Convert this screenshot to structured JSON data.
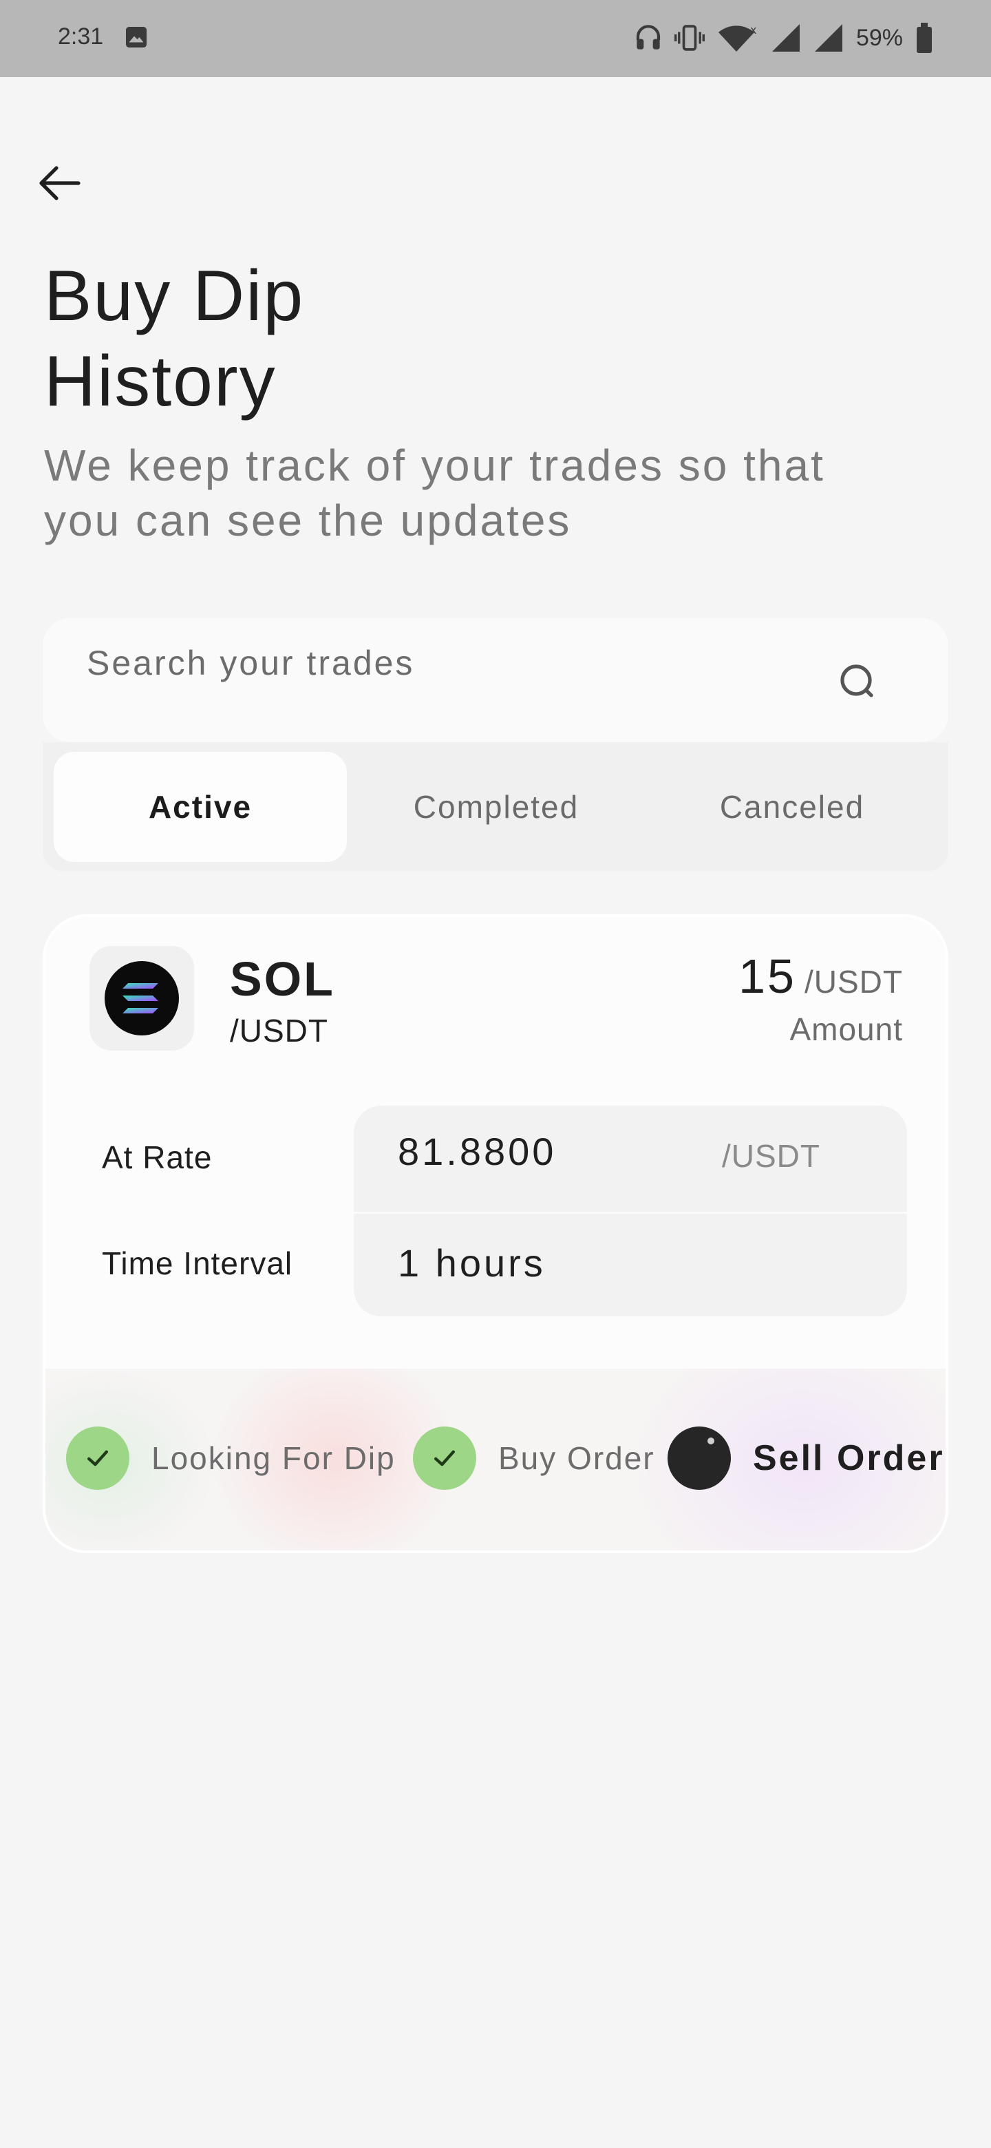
{
  "status_bar": {
    "time": "2:31",
    "battery": "59%"
  },
  "page": {
    "title_line1": "Buy Dip",
    "title_line2": "History",
    "subtitle": "We keep track of your trades so that you can see the updates"
  },
  "search": {
    "placeholder": "Search your trades"
  },
  "tabs": [
    {
      "label": "Active",
      "active": true
    },
    {
      "label": "Completed",
      "active": false
    },
    {
      "label": "Canceled",
      "active": false
    }
  ],
  "trade": {
    "symbol": "SOL",
    "pair": "/USDT",
    "amount": "15",
    "amount_unit": "/USDT",
    "amount_label": "Amount",
    "rate_label": "At Rate",
    "rate_value": "81.8800",
    "rate_unit": "/USDT",
    "interval_label": "Time Interval",
    "interval_value": "1 hours",
    "steps": [
      {
        "label": "Looking For Dip",
        "state": "done"
      },
      {
        "label": "Buy Order",
        "state": "done"
      },
      {
        "label": "Sell Order",
        "state": "current"
      }
    ]
  },
  "colors": {
    "step_done": "#9ed688",
    "step_current": "#262626",
    "background": "#f5f5f5"
  }
}
